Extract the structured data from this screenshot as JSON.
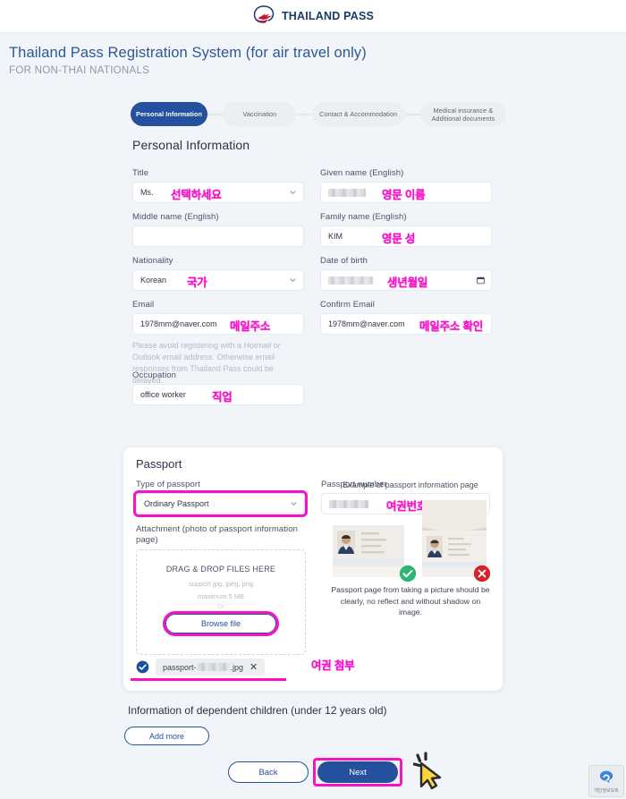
{
  "brand": {
    "logo_icon": "thailand-pass-bird-logo",
    "name": "THAILAND PASS",
    "navy": "#24509e",
    "red": "#c8102e",
    "annotation_pink": "#f513c8"
  },
  "heading": {
    "title": "Thailand Pass Registration System (for air travel only)",
    "subtitle": "FOR NON-THAI NATIONALS"
  },
  "stepper": {
    "steps": [
      {
        "label": "Personal Information",
        "active": true
      },
      {
        "label": "Vaccination",
        "active": false
      },
      {
        "label": "Contact & Accommodation",
        "active": false
      },
      {
        "label": "Medical insurance &\nAdditional documents",
        "active": false
      }
    ]
  },
  "section": {
    "title": "Personal Information"
  },
  "form": {
    "title": {
      "label": "Title",
      "value": "Ms.",
      "annotation": "선택하세요",
      "control": "select"
    },
    "given_name": {
      "label": "Given name (English)",
      "value": "",
      "redacted": true,
      "annotation": "영문 이름"
    },
    "middle_name": {
      "label": "Middle name (English)",
      "value": "",
      "annotation": ""
    },
    "family_name": {
      "label": "Family name (English)",
      "value": "KIM",
      "annotation": "영문 성"
    },
    "nationality": {
      "label": "Nationality",
      "value": "Korean",
      "annotation": "국가",
      "control": "select"
    },
    "date_of_birth": {
      "label": "Date of birth",
      "value": "",
      "redacted": true,
      "annotation": "생년월일",
      "icon": "calendar-icon"
    },
    "email": {
      "label": "Email",
      "value": "1978mm@naver.com",
      "annotation": "메일주소"
    },
    "confirm_email": {
      "label": "Confirm Email",
      "value": "1978mm@naver.com",
      "annotation": "메일주소 확인"
    },
    "email_note": "Please avoid registering with a Hotmail or Outlook email address. Otherwise email responses from Thailand Pass could be delayed.",
    "occupation": {
      "label": "Occupation",
      "value": "office worker",
      "annotation": "직업"
    }
  },
  "passport": {
    "card_title": "Passport",
    "type": {
      "label": "Type of passport",
      "value": "Ordinary Passport",
      "highlighted": true,
      "control": "select"
    },
    "number": {
      "label": "Passport number",
      "value": "",
      "redacted": true,
      "annotation": "여권번호"
    },
    "attachment": {
      "label": "Attachment (photo of passport information page)",
      "drop_title": "DRAG & DROP FILES HERE",
      "support": "support jpg, jpeg, png",
      "maximum": "maximum 5 MB",
      "or": "Or",
      "browse_label": "Browse file",
      "browse_highlighted": true,
      "annotation": "여권 첨부",
      "file": {
        "name_prefix": "passport-",
        "name_suffix": ".jpg",
        "redacted": true,
        "check_icon": "check-circle-icon",
        "remove_icon": "close-icon"
      }
    },
    "example": {
      "title": "Example of passport information page",
      "good_icon": "check-circle-green-icon",
      "bad_icon": "cross-circle-red-icon",
      "caption": "Passport page from taking a picture should be clearly, no reflect and without shadow on image."
    }
  },
  "dependents": {
    "title": "Information of dependent children (under 12 years old)",
    "add_more_label": "Add more"
  },
  "footer": {
    "back_label": "Back",
    "next_label": "Next",
    "next_highlighted": true,
    "cursor_icon": "mouse-click-cursor-icon"
  },
  "watermark": {
    "icon": "privacy-shield-icon",
    "label": "개인정보보호"
  }
}
